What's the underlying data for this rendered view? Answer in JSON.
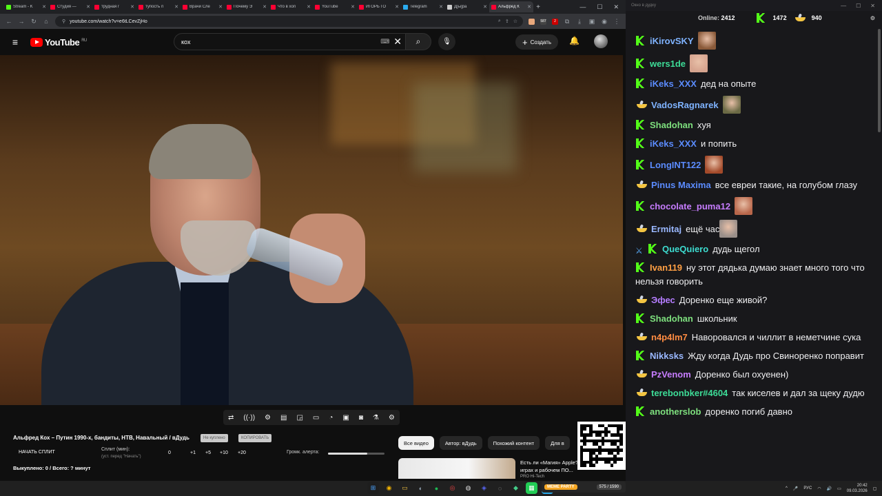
{
  "browser": {
    "tabs": [
      {
        "label": "Stream - K",
        "color": "#53fc18"
      },
      {
        "label": "Студия —",
        "color": "#ff0033"
      },
      {
        "label": "трудная г",
        "color": "#ff0033"
      },
      {
        "label": "тупость п",
        "color": "#ff0033"
      },
      {
        "label": "Врачи Сле",
        "color": "#ff0033"
      },
      {
        "label": "Почему Э",
        "color": "#ff0033"
      },
      {
        "label": "Что в хоп",
        "color": "#ff0033"
      },
      {
        "label": "YouTube",
        "color": "#ff0033"
      },
      {
        "label": "ИГОРЬ ГО",
        "color": "#ff0033"
      },
      {
        "label": "Telegram",
        "color": "#2aabee"
      },
      {
        "label": "Д[ы]ра",
        "color": "#cccccc"
      },
      {
        "label": "Альфред К",
        "color": "#ff0033"
      }
    ],
    "new_tab": "+",
    "url": "youtube.com/watch?v=e6tLCevZjHo",
    "ext_badges": {
      "count1": "587",
      "count2": "2"
    }
  },
  "youtube": {
    "logo": "YouTube",
    "region": "RU",
    "search_value": "кох",
    "create_label": "Создать",
    "video_title": "Альфред Кох – Путин 1990-х, бандиты, НТВ, Навальный / вДудь",
    "chip1": "Не куплено",
    "chip2": "КОПИРОВАТЬ",
    "split_button": "НАЧАТЬ СПЛИТ",
    "split_label": "Сплит (мин):",
    "split_hint": "(уст. перед \"Начать\")",
    "split_values": [
      "0",
      "+1",
      "+5",
      "+10",
      "+20"
    ],
    "alert_label": "Громк. алерта:",
    "alert_volume": 0.7,
    "bought": "Выкуплено: 0 / Всего: ? минут",
    "filters": [
      "Все видео",
      "Автор: вДудь",
      "Похожий контент",
      "Для в"
    ],
    "rec_title": "Есть ли «Магия» Apple? Тест в играх и рабочем ПО...",
    "rec_channel": "PRO Hi-Tech"
  },
  "chat": {
    "window_title": "Окно в дудку",
    "online_label": "Online:",
    "online": "2412",
    "kick_count": "1472",
    "bowl_count": "940",
    "messages": [
      {
        "badges": [
          "k"
        ],
        "nick": "iKirovSKY",
        "color": "#7fb3ff",
        "text": "",
        "emote": "#8a5a3a"
      },
      {
        "badges": [
          "k"
        ],
        "nick": "wers1de",
        "color": "#3ddc97",
        "text": "",
        "emote": "#d6a48f"
      },
      {
        "badges": [
          "k"
        ],
        "nick": "iKeks_XXX",
        "color": "#5b8cff",
        "text": "дед на опыте",
        "emote": ""
      },
      {
        "badges": [
          "b"
        ],
        "nick": "VadosRagnarek",
        "color": "#7fb3ff",
        "text": "",
        "emote": "#6b6a45"
      },
      {
        "badges": [
          "k"
        ],
        "nick": "Shadohan",
        "color": "#7ee07e",
        "text": "хуя",
        "emote": ""
      },
      {
        "badges": [
          "k"
        ],
        "nick": "iKeks_XXX",
        "color": "#5b8cff",
        "text": "и попить",
        "emote": ""
      },
      {
        "badges": [
          "k"
        ],
        "nick": "LongINT122",
        "color": "#5b8cff",
        "text": "",
        "emote": "#a34a2a"
      },
      {
        "badges": [
          "b"
        ],
        "nick": "Pinus Maxima",
        "color": "#5b8cff",
        "text": "все евреи такие, на голубом глазу",
        "emote": ""
      },
      {
        "badges": [
          "k"
        ],
        "nick": "chocolate_puma12",
        "color": "#c77dff",
        "text": "",
        "emote": "#b8664a"
      },
      {
        "badges": [
          "b"
        ],
        "nick": "Ermitaj",
        "color": "#9ab8ff",
        "text": "ещё час",
        "emote": "#9a8f8a"
      },
      {
        "badges": [
          "s",
          "k"
        ],
        "nick": "QueQuiero",
        "color": "#3ddcd0",
        "text": "дудь щегол",
        "emote": ""
      },
      {
        "badges": [
          "k"
        ],
        "nick": "Ivan119",
        "color": "#ff9f43",
        "text": "ну этот дядька думаю знает много того что нельзя говорить",
        "emote": ""
      },
      {
        "badges": [
          "b"
        ],
        "nick": "Эфес",
        "color": "#b57dff",
        "text": "Доренко еще живой?",
        "emote": ""
      },
      {
        "badges": [
          "k"
        ],
        "nick": "Shadohan",
        "color": "#7ee07e",
        "text": "школьник",
        "emote": ""
      },
      {
        "badges": [
          "b"
        ],
        "nick": "n4p4lm7",
        "color": "#ff8c42",
        "text": "Наворовался и чиллит в неметчине сука",
        "emote": ""
      },
      {
        "badges": [
          "k"
        ],
        "nick": "Nikksks",
        "color": "#9ab8ff",
        "text": "Жду когда Дудь про Свиноренко поправит",
        "emote": ""
      },
      {
        "badges": [
          "b"
        ],
        "nick": "PzVenom",
        "color": "#c77dff",
        "text": "Доренко был охуенен)",
        "emote": ""
      },
      {
        "badges": [
          "b"
        ],
        "nick": "terebonbker#4604",
        "color": "#3ddc97",
        "text": "так киселев и дал за щеку дудю",
        "emote": ""
      },
      {
        "badges": [
          "k"
        ],
        "nick": "anotherslob",
        "color": "#7ee07e",
        "text": "доренко погиб давно",
        "emote": ""
      }
    ]
  },
  "taskbar": {
    "meme_label": "MEME PARTY",
    "meme_count": "575 / 1590",
    "lang": "РУС",
    "time": "20:42",
    "date": "09.03.2026"
  }
}
